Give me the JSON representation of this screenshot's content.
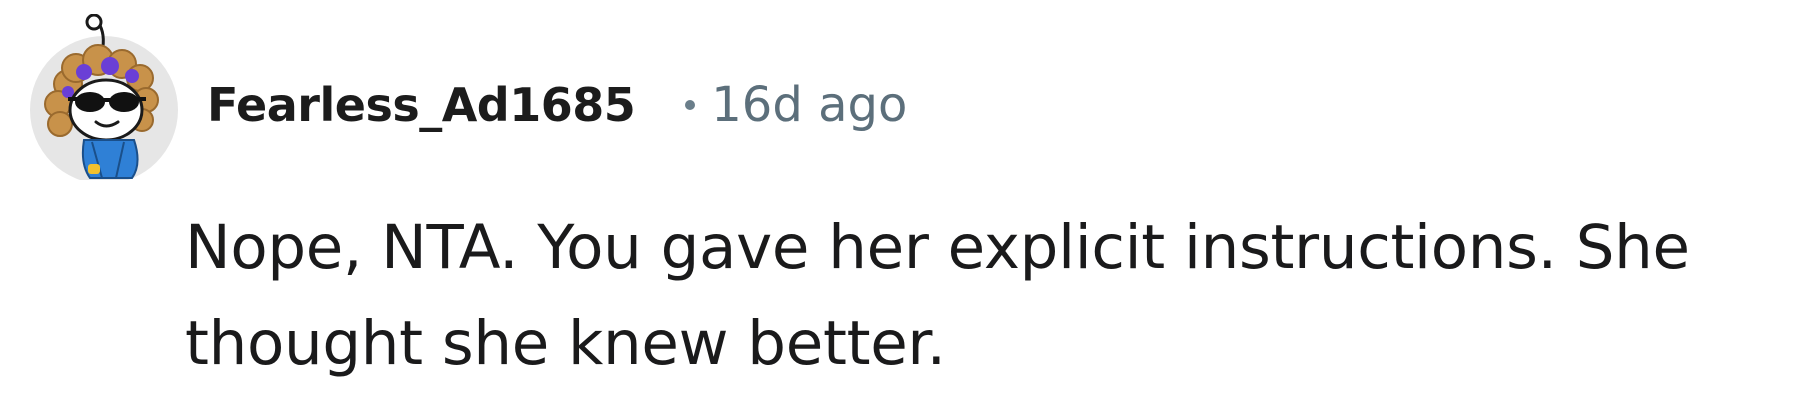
{
  "comment": {
    "username": "Fearless_Ad1685",
    "separator": "•",
    "timestamp": "16d ago",
    "body_line1": "Nope, NTA. You gave her explicit instructions. She",
    "body_line2": "thought she knew better."
  },
  "avatar": {
    "icon": "snoo-avatar-icon",
    "background_color": "#e6e6e6",
    "hair_color": "#c8924a",
    "highlight_color": "#6a3fd6",
    "outfit_color": "#2f80d6"
  },
  "colors": {
    "username": "#1c1c1c",
    "meta": "#5c6f7b",
    "body": "#1a1a1b"
  }
}
